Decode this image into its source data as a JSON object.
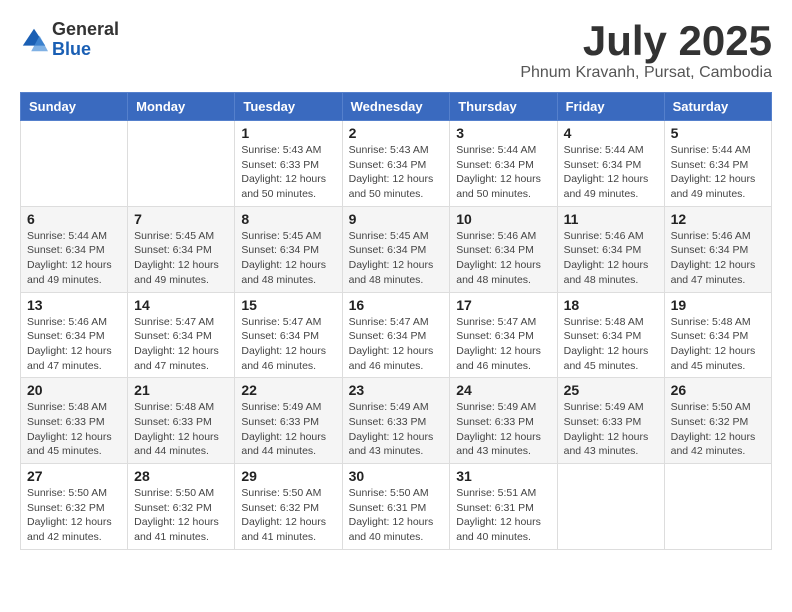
{
  "header": {
    "logo_general": "General",
    "logo_blue": "Blue",
    "month": "July 2025",
    "location": "Phnum Kravanh, Pursat, Cambodia"
  },
  "days_of_week": [
    "Sunday",
    "Monday",
    "Tuesday",
    "Wednesday",
    "Thursday",
    "Friday",
    "Saturday"
  ],
  "weeks": [
    [
      null,
      null,
      {
        "day": "1",
        "sunrise": "Sunrise: 5:43 AM",
        "sunset": "Sunset: 6:33 PM",
        "daylight": "Daylight: 12 hours and 50 minutes."
      },
      {
        "day": "2",
        "sunrise": "Sunrise: 5:43 AM",
        "sunset": "Sunset: 6:34 PM",
        "daylight": "Daylight: 12 hours and 50 minutes."
      },
      {
        "day": "3",
        "sunrise": "Sunrise: 5:44 AM",
        "sunset": "Sunset: 6:34 PM",
        "daylight": "Daylight: 12 hours and 50 minutes."
      },
      {
        "day": "4",
        "sunrise": "Sunrise: 5:44 AM",
        "sunset": "Sunset: 6:34 PM",
        "daylight": "Daylight: 12 hours and 49 minutes."
      },
      {
        "day": "5",
        "sunrise": "Sunrise: 5:44 AM",
        "sunset": "Sunset: 6:34 PM",
        "daylight": "Daylight: 12 hours and 49 minutes."
      }
    ],
    [
      {
        "day": "6",
        "sunrise": "Sunrise: 5:44 AM",
        "sunset": "Sunset: 6:34 PM",
        "daylight": "Daylight: 12 hours and 49 minutes."
      },
      {
        "day": "7",
        "sunrise": "Sunrise: 5:45 AM",
        "sunset": "Sunset: 6:34 PM",
        "daylight": "Daylight: 12 hours and 49 minutes."
      },
      {
        "day": "8",
        "sunrise": "Sunrise: 5:45 AM",
        "sunset": "Sunset: 6:34 PM",
        "daylight": "Daylight: 12 hours and 48 minutes."
      },
      {
        "day": "9",
        "sunrise": "Sunrise: 5:45 AM",
        "sunset": "Sunset: 6:34 PM",
        "daylight": "Daylight: 12 hours and 48 minutes."
      },
      {
        "day": "10",
        "sunrise": "Sunrise: 5:46 AM",
        "sunset": "Sunset: 6:34 PM",
        "daylight": "Daylight: 12 hours and 48 minutes."
      },
      {
        "day": "11",
        "sunrise": "Sunrise: 5:46 AM",
        "sunset": "Sunset: 6:34 PM",
        "daylight": "Daylight: 12 hours and 48 minutes."
      },
      {
        "day": "12",
        "sunrise": "Sunrise: 5:46 AM",
        "sunset": "Sunset: 6:34 PM",
        "daylight": "Daylight: 12 hours and 47 minutes."
      }
    ],
    [
      {
        "day": "13",
        "sunrise": "Sunrise: 5:46 AM",
        "sunset": "Sunset: 6:34 PM",
        "daylight": "Daylight: 12 hours and 47 minutes."
      },
      {
        "day": "14",
        "sunrise": "Sunrise: 5:47 AM",
        "sunset": "Sunset: 6:34 PM",
        "daylight": "Daylight: 12 hours and 47 minutes."
      },
      {
        "day": "15",
        "sunrise": "Sunrise: 5:47 AM",
        "sunset": "Sunset: 6:34 PM",
        "daylight": "Daylight: 12 hours and 46 minutes."
      },
      {
        "day": "16",
        "sunrise": "Sunrise: 5:47 AM",
        "sunset": "Sunset: 6:34 PM",
        "daylight": "Daylight: 12 hours and 46 minutes."
      },
      {
        "day": "17",
        "sunrise": "Sunrise: 5:47 AM",
        "sunset": "Sunset: 6:34 PM",
        "daylight": "Daylight: 12 hours and 46 minutes."
      },
      {
        "day": "18",
        "sunrise": "Sunrise: 5:48 AM",
        "sunset": "Sunset: 6:34 PM",
        "daylight": "Daylight: 12 hours and 45 minutes."
      },
      {
        "day": "19",
        "sunrise": "Sunrise: 5:48 AM",
        "sunset": "Sunset: 6:34 PM",
        "daylight": "Daylight: 12 hours and 45 minutes."
      }
    ],
    [
      {
        "day": "20",
        "sunrise": "Sunrise: 5:48 AM",
        "sunset": "Sunset: 6:33 PM",
        "daylight": "Daylight: 12 hours and 45 minutes."
      },
      {
        "day": "21",
        "sunrise": "Sunrise: 5:48 AM",
        "sunset": "Sunset: 6:33 PM",
        "daylight": "Daylight: 12 hours and 44 minutes."
      },
      {
        "day": "22",
        "sunrise": "Sunrise: 5:49 AM",
        "sunset": "Sunset: 6:33 PM",
        "daylight": "Daylight: 12 hours and 44 minutes."
      },
      {
        "day": "23",
        "sunrise": "Sunrise: 5:49 AM",
        "sunset": "Sunset: 6:33 PM",
        "daylight": "Daylight: 12 hours and 43 minutes."
      },
      {
        "day": "24",
        "sunrise": "Sunrise: 5:49 AM",
        "sunset": "Sunset: 6:33 PM",
        "daylight": "Daylight: 12 hours and 43 minutes."
      },
      {
        "day": "25",
        "sunrise": "Sunrise: 5:49 AM",
        "sunset": "Sunset: 6:33 PM",
        "daylight": "Daylight: 12 hours and 43 minutes."
      },
      {
        "day": "26",
        "sunrise": "Sunrise: 5:50 AM",
        "sunset": "Sunset: 6:32 PM",
        "daylight": "Daylight: 12 hours and 42 minutes."
      }
    ],
    [
      {
        "day": "27",
        "sunrise": "Sunrise: 5:50 AM",
        "sunset": "Sunset: 6:32 PM",
        "daylight": "Daylight: 12 hours and 42 minutes."
      },
      {
        "day": "28",
        "sunrise": "Sunrise: 5:50 AM",
        "sunset": "Sunset: 6:32 PM",
        "daylight": "Daylight: 12 hours and 41 minutes."
      },
      {
        "day": "29",
        "sunrise": "Sunrise: 5:50 AM",
        "sunset": "Sunset: 6:32 PM",
        "daylight": "Daylight: 12 hours and 41 minutes."
      },
      {
        "day": "30",
        "sunrise": "Sunrise: 5:50 AM",
        "sunset": "Sunset: 6:31 PM",
        "daylight": "Daylight: 12 hours and 40 minutes."
      },
      {
        "day": "31",
        "sunrise": "Sunrise: 5:51 AM",
        "sunset": "Sunset: 6:31 PM",
        "daylight": "Daylight: 12 hours and 40 minutes."
      },
      null,
      null
    ]
  ]
}
